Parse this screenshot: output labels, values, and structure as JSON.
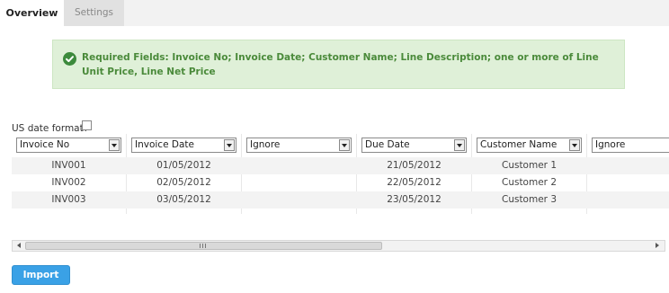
{
  "tabs": [
    {
      "label": "Overview",
      "active": true
    },
    {
      "label": "Settings",
      "active": false
    }
  ],
  "notice": {
    "icon": "check-circle-icon",
    "text": "Required Fields: Invoice No; Invoice Date; Customer Name; Line Description; one or more of Line Unit Price, Line Net Price",
    "color": "#4a8a3a",
    "background": "#dff0d8"
  },
  "options": {
    "us_date_label": "US date format?",
    "us_date_checked": false
  },
  "grid": {
    "columns": [
      {
        "selected": "Invoice No"
      },
      {
        "selected": "Invoice Date"
      },
      {
        "selected": "Ignore"
      },
      {
        "selected": "Due Date"
      },
      {
        "selected": "Customer Name"
      },
      {
        "selected": "Ignore"
      }
    ],
    "rows": [
      [
        "INV001",
        "01/05/2012",
        "",
        "21/05/2012",
        "Customer 1",
        ""
      ],
      [
        "INV002",
        "02/05/2012",
        "",
        "22/05/2012",
        "Customer 2",
        ""
      ],
      [
        "INV003",
        "03/05/2012",
        "",
        "23/05/2012",
        "Customer 3",
        ""
      ]
    ]
  },
  "import_button": {
    "label": "Import",
    "color": "#3aa1e6"
  }
}
